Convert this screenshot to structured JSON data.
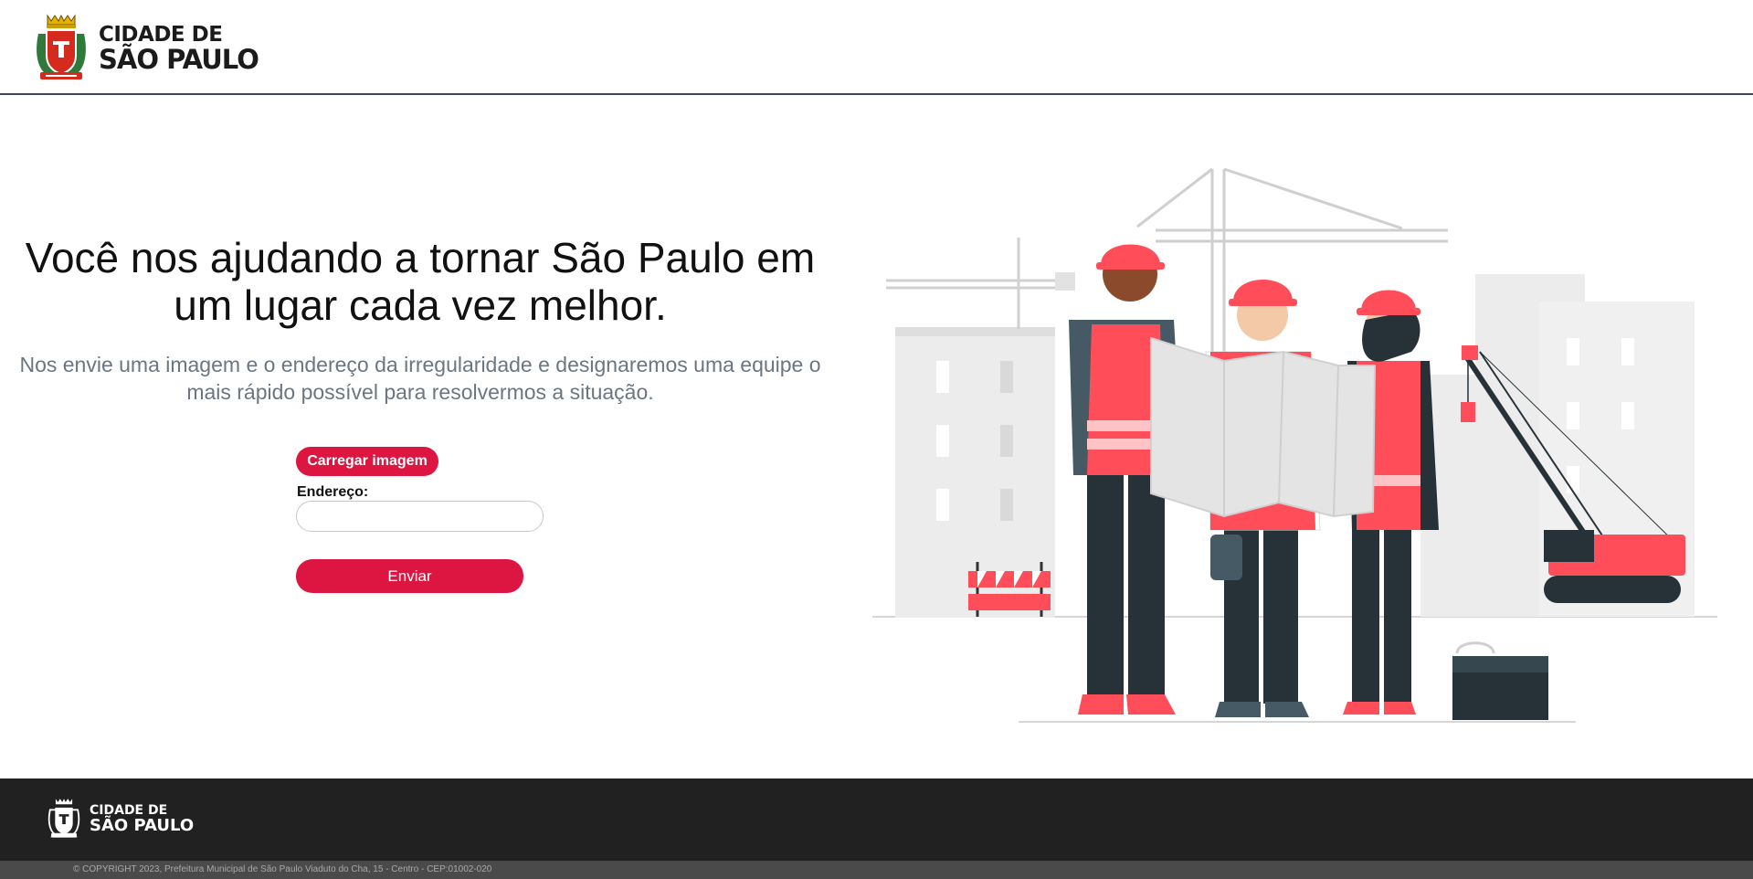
{
  "header": {
    "logo_line1": "CIDADE DE",
    "logo_line2": "SÃO PAULO"
  },
  "hero": {
    "title": "Você nos ajudando a tornar São Paulo em um lugar cada vez melhor.",
    "subtitle": "Nos envie uma imagem e o endereço da irregularidade e designaremos uma equipe o mais rápido possível para resolvermos a situação."
  },
  "form": {
    "upload_label": "Carregar imagem",
    "address_label": "Endereço:",
    "address_value": "",
    "submit_label": "Enviar"
  },
  "footer": {
    "logo_line1": "CIDADE DE",
    "logo_line2": "SÃO PAULO",
    "copyright": "© COPYRIGHT 2023, Prefeitura Municipal de São Paulo Viaduto do Cha, 15 - Centro - CEP:01002-020"
  },
  "colors": {
    "accent": "#dc1641",
    "footer_bg": "#212121",
    "header_border": "#3a4a5c"
  },
  "icons": {
    "header_logo": "sao-paulo-coat-of-arms-icon",
    "footer_logo": "sao-paulo-coat-of-arms-icon"
  }
}
